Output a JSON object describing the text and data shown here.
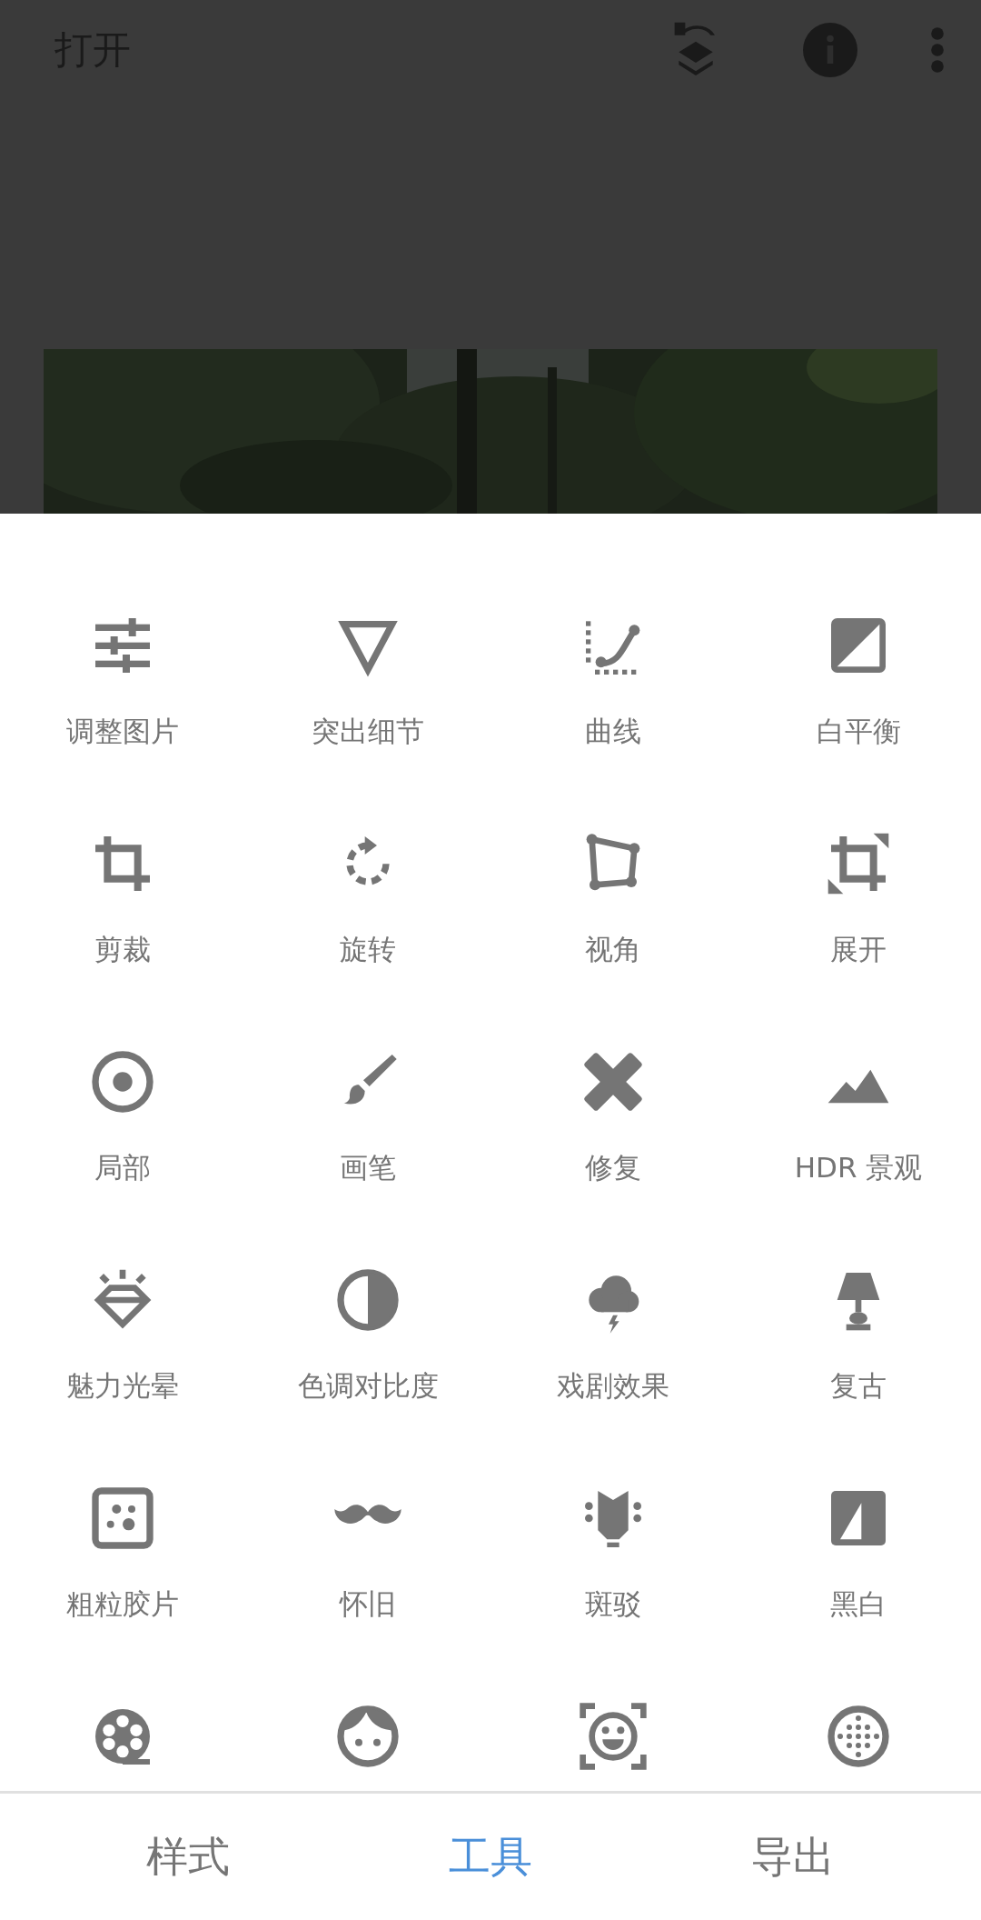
{
  "top_bar": {
    "title": "打开"
  },
  "tools": [
    {
      "kind": "labeled",
      "label": "调整图片"
    },
    {
      "kind": "labeled",
      "label": "突出细节"
    },
    {
      "kind": "labeled",
      "label": "曲线"
    },
    {
      "kind": "labeled",
      "label": "白平衡"
    },
    {
      "kind": "labeled",
      "label": "剪裁"
    },
    {
      "kind": "labeled",
      "label": "旋转"
    },
    {
      "kind": "labeled",
      "label": "视角"
    },
    {
      "kind": "labeled",
      "label": "展开"
    },
    {
      "kind": "labeled",
      "label": "局部"
    },
    {
      "kind": "labeled",
      "label": "画笔"
    },
    {
      "kind": "labeled",
      "label": "修复"
    },
    {
      "kind": "labeled",
      "label": "HDR 景观"
    },
    {
      "kind": "labeled",
      "label": "魅力光晕"
    },
    {
      "kind": "labeled",
      "label": "色调对比度"
    },
    {
      "kind": "labeled",
      "label": "戏剧效果"
    },
    {
      "kind": "labeled",
      "label": "复古"
    },
    {
      "kind": "labeled",
      "label": "粗粒胶片"
    },
    {
      "kind": "labeled",
      "label": "怀旧"
    },
    {
      "kind": "labeled",
      "label": "斑驳"
    },
    {
      "kind": "labeled",
      "label": "黑白"
    },
    {
      "kind": "icon_only"
    },
    {
      "kind": "icon_only"
    },
    {
      "kind": "icon_only"
    },
    {
      "kind": "icon_only"
    }
  ],
  "bottom_tabs": [
    {
      "label": "样式",
      "selected": false
    },
    {
      "label": "工具",
      "selected": true
    },
    {
      "label": "导出",
      "selected": false
    }
  ]
}
